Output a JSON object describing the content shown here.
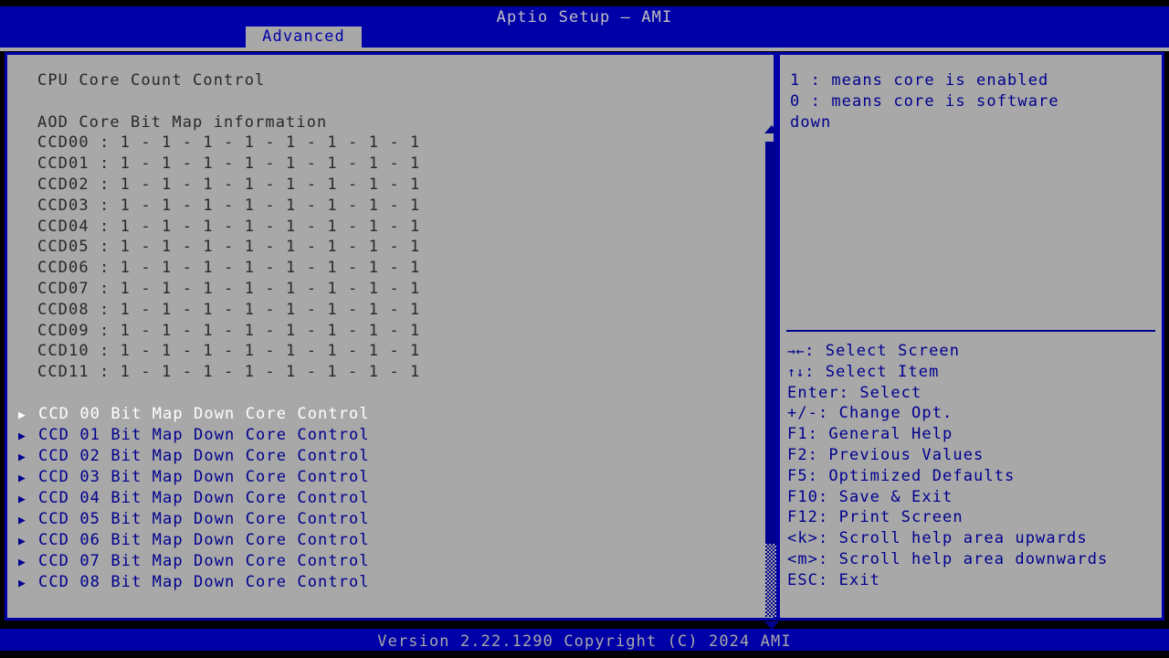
{
  "header": {
    "title": "Aptio Setup – AMI",
    "active_tab": "Advanced",
    "tabs": [
      "Advanced"
    ]
  },
  "main": {
    "section_title": "CPU Core Count Control",
    "bitmap_heading": "AOD Core Bit Map information",
    "bitmap_rows": [
      {
        "label": "CCD00",
        "bits": "1 - 1 - 1 - 1 - 1 - 1 - 1 - 1",
        "text": "CCD00 : 1 - 1 - 1 - 1 - 1 - 1 - 1 - 1"
      },
      {
        "label": "CCD01",
        "bits": "1 - 1 - 1 - 1 - 1 - 1 - 1 - 1",
        "text": "CCD01 : 1 - 1 - 1 - 1 - 1 - 1 - 1 - 1"
      },
      {
        "label": "CCD02",
        "bits": "1 - 1 - 1 - 1 - 1 - 1 - 1 - 1",
        "text": "CCD02 : 1 - 1 - 1 - 1 - 1 - 1 - 1 - 1"
      },
      {
        "label": "CCD03",
        "bits": "1 - 1 - 1 - 1 - 1 - 1 - 1 - 1",
        "text": "CCD03 : 1 - 1 - 1 - 1 - 1 - 1 - 1 - 1"
      },
      {
        "label": "CCD04",
        "bits": "1 - 1 - 1 - 1 - 1 - 1 - 1 - 1",
        "text": "CCD04 : 1 - 1 - 1 - 1 - 1 - 1 - 1 - 1"
      },
      {
        "label": "CCD05",
        "bits": "1 - 1 - 1 - 1 - 1 - 1 - 1 - 1",
        "text": "CCD05 : 1 - 1 - 1 - 1 - 1 - 1 - 1 - 1"
      },
      {
        "label": "CCD06",
        "bits": "1 - 1 - 1 - 1 - 1 - 1 - 1 - 1",
        "text": "CCD06 : 1 - 1 - 1 - 1 - 1 - 1 - 1 - 1"
      },
      {
        "label": "CCD07",
        "bits": "1 - 1 - 1 - 1 - 1 - 1 - 1 - 1",
        "text": "CCD07 : 1 - 1 - 1 - 1 - 1 - 1 - 1 - 1"
      },
      {
        "label": "CCD08",
        "bits": "1 - 1 - 1 - 1 - 1 - 1 - 1 - 1",
        "text": "CCD08 : 1 - 1 - 1 - 1 - 1 - 1 - 1 - 1"
      },
      {
        "label": "CCD09",
        "bits": "1 - 1 - 1 - 1 - 1 - 1 - 1 - 1",
        "text": "CCD09 : 1 - 1 - 1 - 1 - 1 - 1 - 1 - 1"
      },
      {
        "label": "CCD10",
        "bits": "1 - 1 - 1 - 1 - 1 - 1 - 1 - 1",
        "text": "CCD10 : 1 - 1 - 1 - 1 - 1 - 1 - 1 - 1"
      },
      {
        "label": "CCD11",
        "bits": "1 - 1 - 1 - 1 - 1 - 1 - 1 - 1",
        "text": "CCD11 : 1 - 1 - 1 - 1 - 1 - 1 - 1 - 1"
      }
    ],
    "menu_items": [
      {
        "label": "CCD 00 Bit Map Down Core Control",
        "selected": true
      },
      {
        "label": "CCD 01 Bit Map Down Core Control",
        "selected": false
      },
      {
        "label": "CCD 02 Bit Map Down Core Control",
        "selected": false
      },
      {
        "label": "CCD 03 Bit Map Down Core Control",
        "selected": false
      },
      {
        "label": "CCD 04 Bit Map Down Core Control",
        "selected": false
      },
      {
        "label": "CCD 05 Bit Map Down Core Control",
        "selected": false
      },
      {
        "label": "CCD 06 Bit Map Down Core Control",
        "selected": false
      },
      {
        "label": "CCD 07 Bit Map Down Core Control",
        "selected": false
      },
      {
        "label": "CCD 08 Bit Map Down Core Control",
        "selected": false
      }
    ],
    "submenu_arrow": "▶"
  },
  "help": {
    "description_lines": [
      "1 : means core is enabled",
      "0 : means core is software",
      "down"
    ],
    "keys": [
      {
        "glyph": "→←",
        "text": ": Select Screen"
      },
      {
        "glyph": "↑↓",
        "text": ": Select Item"
      },
      {
        "glyph": "",
        "text": "Enter: Select"
      },
      {
        "glyph": "",
        "text": "+/-: Change Opt."
      },
      {
        "glyph": "",
        "text": "F1: General Help"
      },
      {
        "glyph": "",
        "text": "F2: Previous Values"
      },
      {
        "glyph": "",
        "text": "F5: Optimized Defaults"
      },
      {
        "glyph": "",
        "text": "F10: Save & Exit"
      },
      {
        "glyph": "",
        "text": "F12: Print Screen"
      },
      {
        "glyph": "",
        "text": "<k>: Scroll help area upwards"
      },
      {
        "glyph": "",
        "text": "<m>: Scroll help area downwards"
      },
      {
        "glyph": "",
        "text": "ESC: Exit"
      }
    ]
  },
  "footer": {
    "version_text": "Version 2.22.1290 Copyright (C) 2024 AMI"
  },
  "colors": {
    "banner_blue": "#0000a8",
    "panel_gray": "#a8a8a8",
    "text_blue": "#00008f",
    "text_dark": "#282828",
    "selected_white": "#ffffff",
    "background_black": "#000000"
  },
  "scrollbar": {
    "up_arrow": "▲",
    "down_arrow": "▼"
  }
}
